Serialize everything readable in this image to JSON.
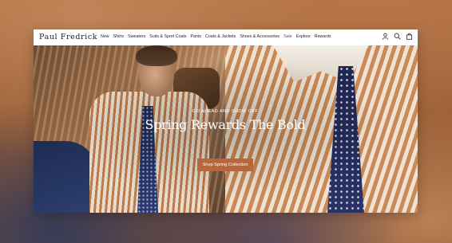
{
  "brand": {
    "logo_text": "Paul Fredrick"
  },
  "nav": {
    "items": [
      {
        "label": "New"
      },
      {
        "label": "Shirts"
      },
      {
        "label": "Sweaters"
      },
      {
        "label": "Suits & Sport Coats"
      },
      {
        "label": "Pants"
      },
      {
        "label": "Coats & Jackets"
      },
      {
        "label": "Shoes & Accessories"
      },
      {
        "label": "Sale"
      },
      {
        "label": "Explore"
      },
      {
        "label": "Rewards"
      }
    ],
    "icons": [
      "account-icon",
      "search-icon",
      "bag-icon"
    ]
  },
  "hero": {
    "eyebrow": "GO AHEAD AND SHOW OFF",
    "headline": "Spring Rewards The Bold",
    "cta_label": "Shop Spring Collection"
  },
  "colors": {
    "cta_background": "#b5683d",
    "nav_text": "#222222",
    "backdrop": "#8a5530"
  }
}
